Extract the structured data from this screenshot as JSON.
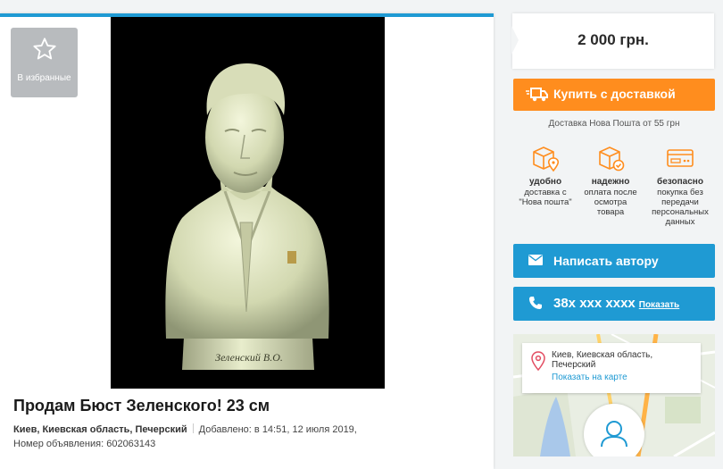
{
  "listing": {
    "title": "Продам Бюст Зеленского! 23 см",
    "location": "Киев, Киевская область, Печерский",
    "added": "Добавлено: в 14:51, 12 июля 2019,",
    "ad_number": "Номер объявления: 602063143",
    "favorite_label": "В избранные",
    "photo_caption": "Зеленский В.О."
  },
  "sidebar": {
    "price": "2 000 грн.",
    "buy_label": "Купить с доставкой",
    "delivery_note": "Доставка Нова Пошта от 55 грн",
    "features": [
      {
        "title": "удобно",
        "text": "доставка с \"Нова пошта\"",
        "icon": "box-location-icon"
      },
      {
        "title": "надежно",
        "text": "оплата после осмотра товара",
        "icon": "box-check-icon"
      },
      {
        "title": "безопасно",
        "text": "покупка без передачи персональных данных",
        "icon": "card-icon"
      }
    ],
    "message_label": "Написать автору",
    "phone_label": "38x xxx xxxx",
    "phone_show": "Показать",
    "map_address": "Киев, Киевская область, Печерский",
    "map_link": "Показать на карте"
  },
  "colors": {
    "accent_blue": "#1f9ad3",
    "accent_orange": "#ff8d1e"
  }
}
